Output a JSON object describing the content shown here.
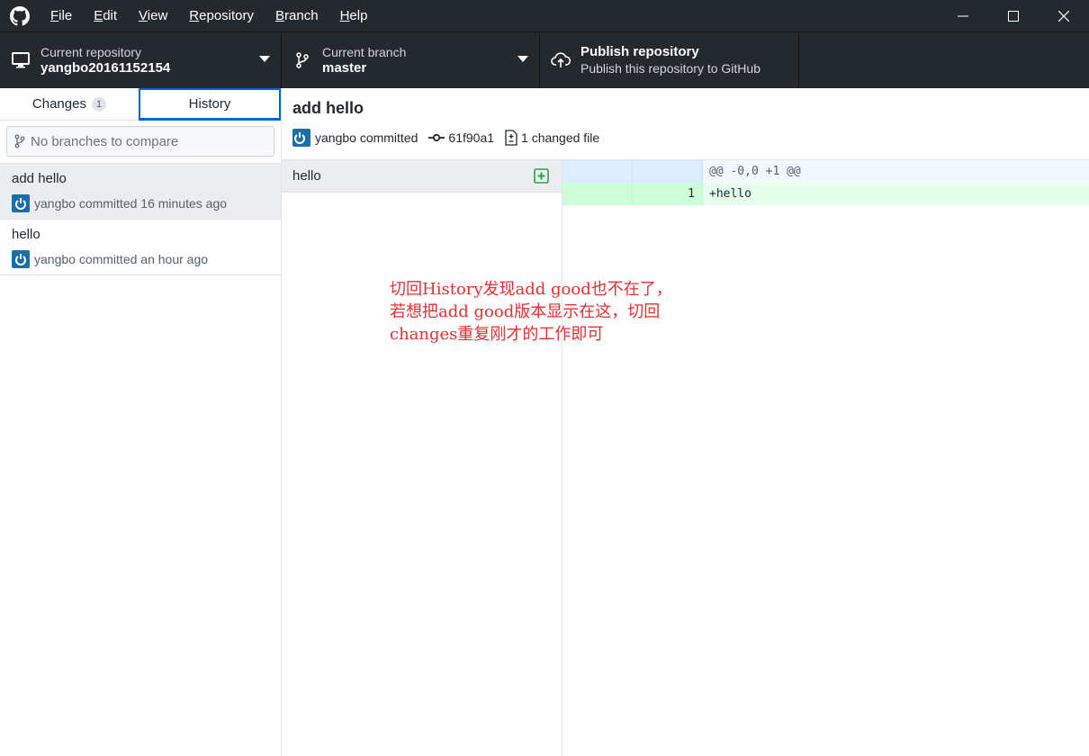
{
  "menu": {
    "items": [
      {
        "u": "F",
        "rest": "ile"
      },
      {
        "u": "E",
        "rest": "dit"
      },
      {
        "u": "V",
        "rest": "iew"
      },
      {
        "u": "R",
        "rest": "epository"
      },
      {
        "u": "B",
        "rest": "ranch"
      },
      {
        "u": "H",
        "rest": "elp"
      }
    ]
  },
  "toolbar": {
    "repo_title": "Current repository",
    "repo_value": "yangbo20161152154",
    "branch_title": "Current branch",
    "branch_value": "master",
    "publish_title": "Publish repository",
    "publish_sub": "Publish this repository to GitHub"
  },
  "sidebar": {
    "tab_changes": "Changes",
    "tab_changes_count": "1",
    "tab_history": "History",
    "compare_placeholder": "No branches to compare",
    "commits": [
      {
        "title": "add hello",
        "meta": "yangbo committed 16 minutes ago"
      },
      {
        "title": "hello",
        "meta": "yangbo committed an hour ago"
      }
    ]
  },
  "commit": {
    "title": "add hello",
    "author": "yangbo committed",
    "sha": "61f90a1",
    "changed": "1 changed file"
  },
  "files": [
    {
      "name": "hello"
    }
  ],
  "diff": {
    "hunk": "@@ -0,0 +1 @@",
    "line_no": "1",
    "line": "+hello"
  },
  "annotation": {
    "line1": "切回History发现add good也不在了，",
    "line2": "若想把add good版本显示在这，切回",
    "line3": "changes重复刚才的工作即可"
  },
  "colors": {
    "dark": "#24292e",
    "accent": "#0366d6",
    "annotation": "#e83030"
  }
}
